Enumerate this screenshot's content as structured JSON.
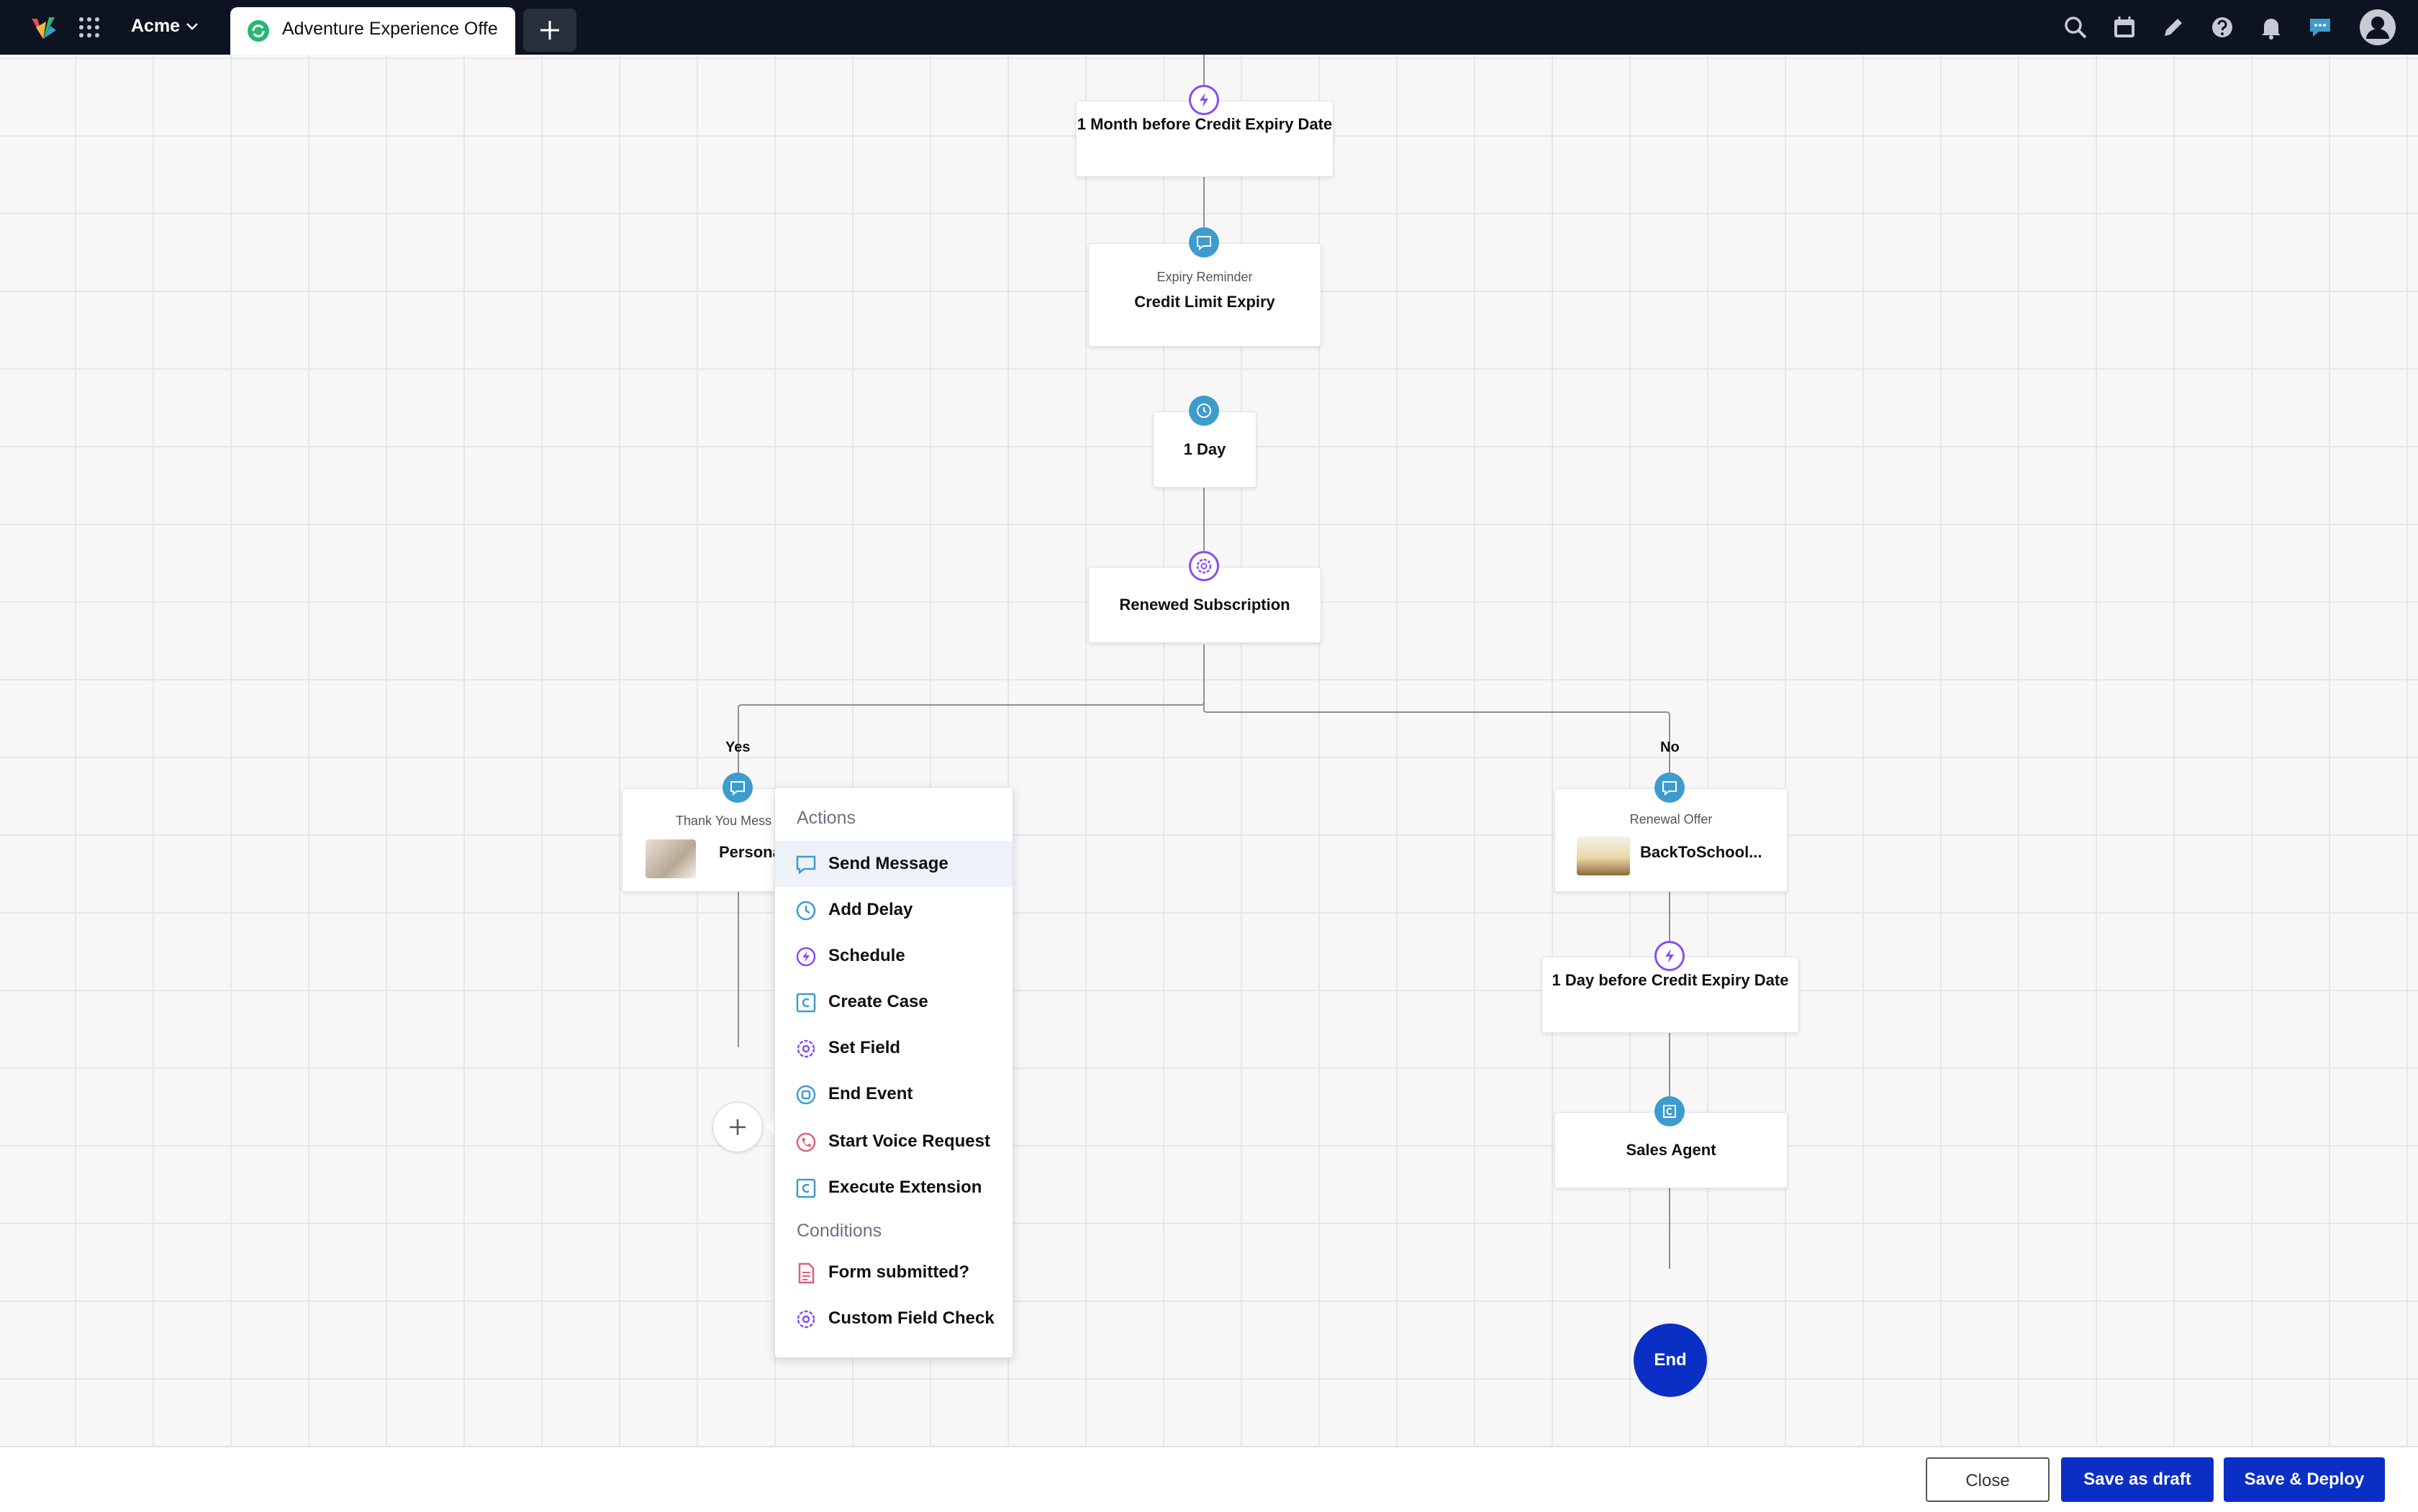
{
  "topbar": {
    "brand": "Acme",
    "tab_title": "Adventure Experience Offe"
  },
  "flow": {
    "trigger1": "1 Month before Credit Expiry Date",
    "msg1_sub": "Expiry Reminder",
    "msg1_title": "Credit Limit Expiry",
    "delay1": "1 Day",
    "condition1": "Renewed Subscription",
    "yes_label": "Yes",
    "no_label": "No",
    "yes_msg_sub": "Thank You Mess",
    "yes_msg_title": "Persona",
    "no_msg_sub": "Renewal Offer",
    "no_msg_title": "BackToSchool...",
    "trigger2": "1 Day before Credit Expiry Date",
    "case_title": "Sales Agent",
    "end_label": "End"
  },
  "menu": {
    "actions_header": "Actions",
    "actions": [
      {
        "label": "Send Message",
        "icon": "chat-icon",
        "color": "#3d9ccd"
      },
      {
        "label": "Add Delay",
        "icon": "clock-icon",
        "color": "#3d9ccd"
      },
      {
        "label": "Schedule",
        "icon": "bolt-icon",
        "color": "#8a4cf0"
      },
      {
        "label": "Create Case",
        "icon": "case-icon",
        "color": "#3d9ccd"
      },
      {
        "label": "Set Field",
        "icon": "gear-icon",
        "color": "#8a4cf0"
      },
      {
        "label": "End Event",
        "icon": "stop-icon",
        "color": "#3d9ccd"
      },
      {
        "label": "Start Voice Request",
        "icon": "phone-icon",
        "color": "#e0607a"
      },
      {
        "label": "Execute Extension",
        "icon": "extension-icon",
        "color": "#3d9ccd"
      }
    ],
    "conditions_header": "Conditions",
    "conditions": [
      {
        "label": "Form submitted?",
        "icon": "form-icon",
        "color": "#e0607a"
      },
      {
        "label": "Custom Field Check",
        "icon": "gear-icon",
        "color": "#8a4cf0"
      }
    ]
  },
  "footer": {
    "close": "Close",
    "save_draft": "Save as draft",
    "save_deploy": "Save & Deploy"
  },
  "colors": {
    "topbar": "#0e1321",
    "primary": "#0b2fc5",
    "message_badge": "#3d9ccd",
    "trigger_badge": "#8a4cf0"
  }
}
